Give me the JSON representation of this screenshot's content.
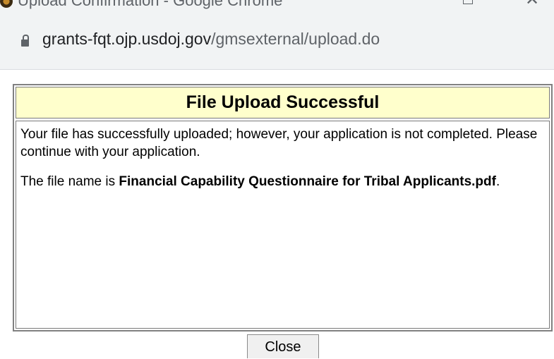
{
  "window": {
    "title": "Upload Confirmation - Google Chrome"
  },
  "address_bar": {
    "domain": "grants-fqt.ojp.usdoj.gov",
    "path": "/gmsexternal/upload.do"
  },
  "dialog": {
    "header": "File Upload Successful",
    "message_line": "Your file has successfully uploaded; however, your application is not completed. Please continue with your application.",
    "file_prefix": "The file name is ",
    "file_name": "Financial Capability Questionnaire for Tribal Applicants.pdf",
    "file_suffix": "."
  },
  "buttons": {
    "close_label": "Close"
  },
  "colors": {
    "header_background": "#ffffcc",
    "chrome_background": "#f1f3f4"
  }
}
